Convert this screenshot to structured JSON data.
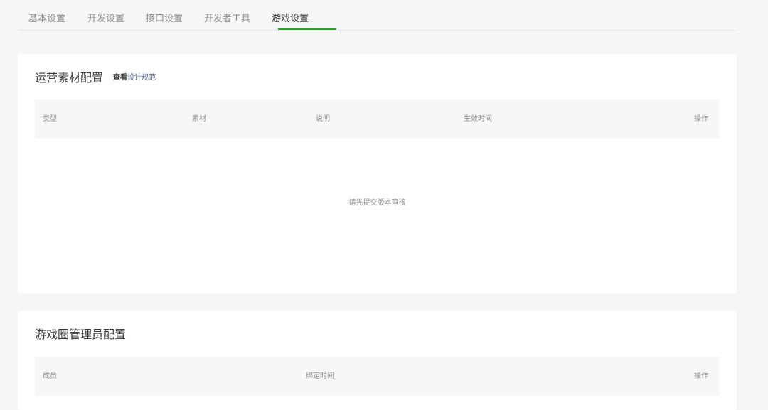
{
  "tabs": [
    {
      "label": "基本设置",
      "active": false
    },
    {
      "label": "开发设置",
      "active": false
    },
    {
      "label": "接口设置",
      "active": false
    },
    {
      "label": "开发者工具",
      "active": false
    },
    {
      "label": "游戏设置",
      "active": true
    }
  ],
  "colors": {
    "accent": "#1aad19",
    "link": "#576b95",
    "muted_text": "#8b8b8b",
    "page_bg": "#f6f6f6"
  },
  "materials": {
    "title": "运营素材配置",
    "link_prefix": "查看",
    "link_text": "设计规范",
    "columns": [
      "类型",
      "素材",
      "说明",
      "生效时间",
      "操作"
    ],
    "empty_text": "请先提交版本审核"
  },
  "admins": {
    "title": "游戏圈管理员配置",
    "columns": [
      "成员",
      "绑定时间",
      "操作"
    ]
  }
}
